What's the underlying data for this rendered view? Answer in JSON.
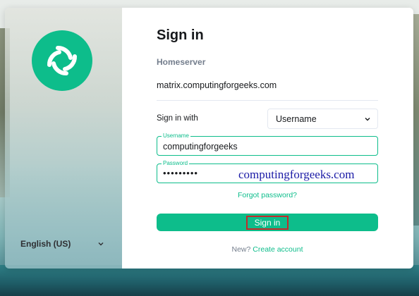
{
  "theme": {
    "accent": "#0dbd8b",
    "text_primary": "#17191c",
    "text_secondary": "#737d8c",
    "highlight_border": "#c22b2b",
    "watermark_color": "#1a1aa6"
  },
  "left_pane": {
    "logo_icon": "element-logo-icon",
    "language": "English (US)"
  },
  "form": {
    "title": "Sign in",
    "homeserver_label": "Homeserver",
    "homeserver_value": "matrix.computingforgeeks.com",
    "sign_in_with_label": "Sign in with",
    "sign_in_with_selected": "Username",
    "username_label": "Username",
    "username_value": "computingforgeeks",
    "password_label": "Password",
    "password_masked": "•••••••••",
    "forgot_password": "Forgot password?",
    "sign_in_button": "Sign in",
    "new_prompt": "New?",
    "create_account": "Create account"
  },
  "watermark": "computingforgeeks.com"
}
